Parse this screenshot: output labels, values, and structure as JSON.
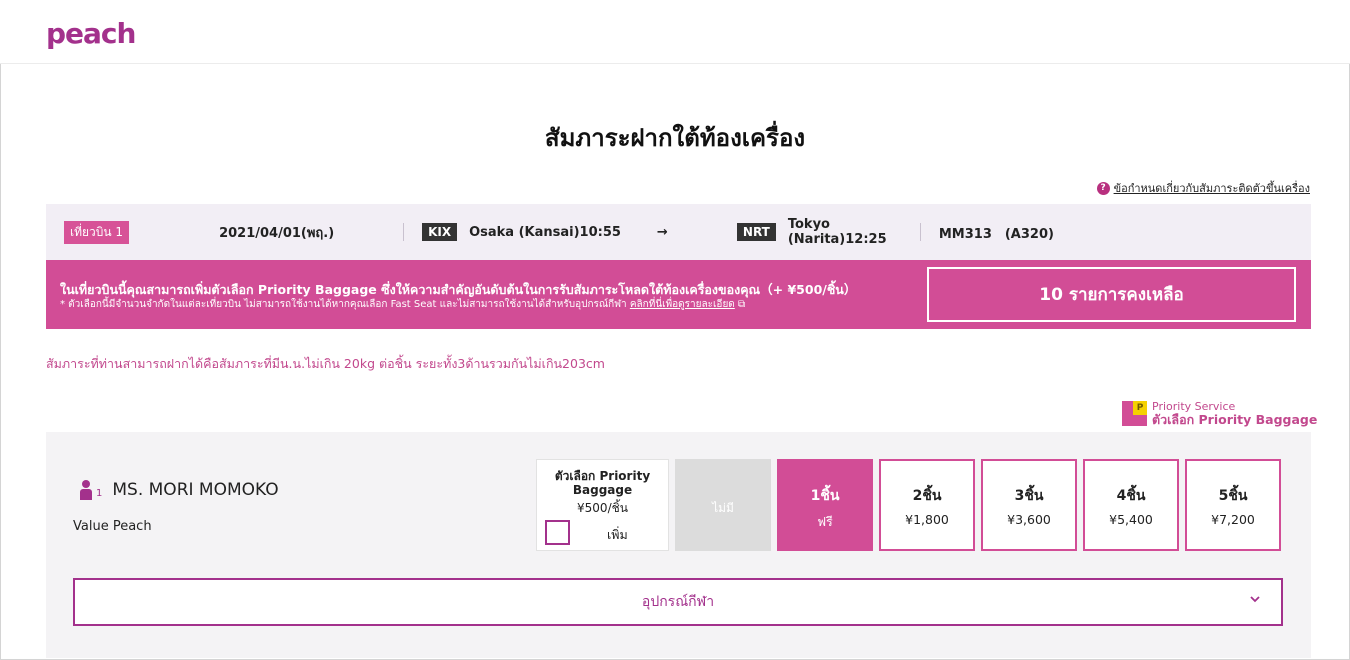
{
  "brand": {
    "logo_text": "peach",
    "primary_color": "#a3318c",
    "accent_color": "#d24d96"
  },
  "page": {
    "title": "สัมภาระฝากใต้ท้องเครื่อง"
  },
  "help_link": {
    "label": "ข้อกำหนดเกี่ยวกับสัมภาระติดตัวขึ้นเครื่อง",
    "icon": "question-circle-icon"
  },
  "flight": {
    "tag": "เที่ยวบิน 1",
    "date": "2021/04/01(พฤ.)",
    "origin_code": "KIX",
    "origin_name": "Osaka (Kansai)10:55",
    "arrow": "→",
    "dest_code": "NRT",
    "dest_name": "Tokyo (Narita)12:25",
    "flight_number": "MM313　(A320)"
  },
  "banner": {
    "main_text": "ในเที่ยวบินนี้คุณสามารถเพิ่มตัวเลือก Priority Baggage ซึ่งให้ความสำคัญอันดับต้นในการรับสัมภาระโหลดใต้ท้องเครื่องของคุณ（+ ¥500/ชิ้น）",
    "sub_text": "* ตัวเลือกนี้มีจำนวนจำกัดในแต่ละเที่ยวบิน ไม่สามารถใช้งานได้หากคุณเลือก Fast Seat และไม่สามารถใช้งานได้สำหรับอุปกรณ์กีฬา",
    "sub_link": "คลิกที่นี่เพื่อดูรายละเอียด",
    "remaining_label": "10 รายการคงเหลือ"
  },
  "limit_note": "สัมภาระที่ท่านสามารถฝากได้คือสัมภาระที่มีน.น.ไม่เกิน 20kg ต่อชิ้น ระยะทั้ง3ด้านรวมกันไม่เกิน203cm",
  "priority_legend": {
    "line1": "Priority Service",
    "line2": "ตัวเลือก Priority Baggage",
    "icon_letter": "P"
  },
  "passenger": {
    "number": "1",
    "name": "MS. MORI MOMOKO",
    "fare_type": "Value Peach",
    "priority_option": {
      "title": "ตัวเลือก Priority Baggage",
      "price": "¥500/ชิ้น",
      "add_label": "เพิ่ม"
    },
    "options": [
      {
        "count": "ไม่มี",
        "price": "",
        "state": "disabled"
      },
      {
        "count": "1ชิ้น",
        "price": "ฟรี",
        "state": "selected"
      },
      {
        "count": "2ชิ้น",
        "price": "¥1,800",
        "state": "normal"
      },
      {
        "count": "3ชิ้น",
        "price": "¥3,600",
        "state": "normal"
      },
      {
        "count": "4ชิ้น",
        "price": "¥5,400",
        "state": "normal"
      },
      {
        "count": "5ชิ้น",
        "price": "¥7,200",
        "state": "normal"
      }
    ],
    "sports_equipment_label": "อุปกรณ์กีฬา"
  }
}
